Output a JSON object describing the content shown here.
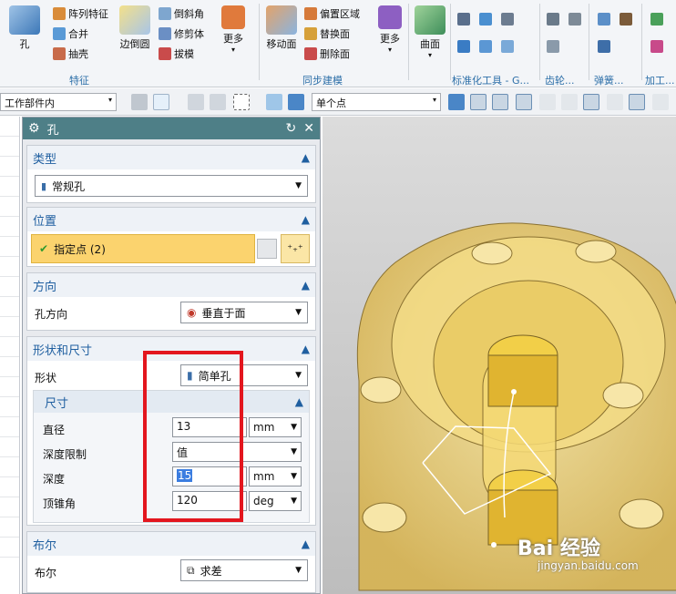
{
  "ribbon": {
    "g1": {
      "hole": "孔",
      "array": "阵列特征",
      "combine": "合并",
      "shell": "抽壳",
      "label": "特征"
    },
    "g2": {
      "edge_blend": "边倒圆",
      "chamfer": "倒斜角",
      "trim": "修剪体",
      "draft": "拔模",
      "more": "更多"
    },
    "g3": {
      "move_face": "移动面",
      "offset_region": "偏置区域",
      "replace_face": "替换面",
      "delete_face": "删除面",
      "more": "更多",
      "label": "同步建模"
    },
    "g4": {
      "surface": "曲面",
      "std_label": "标准化工具 - G...",
      "gear_label": "齿轮...",
      "spring_label": "弹簧...",
      "process_label": "加工..."
    }
  },
  "toolbar": {
    "scope": "工作部件内",
    "point_type": "单个点"
  },
  "dialog": {
    "title": "孔",
    "type": {
      "header": "类型",
      "value": "常规孔"
    },
    "position": {
      "header": "位置",
      "specify_point": "指定点 (2)"
    },
    "direction": {
      "header": "方向",
      "label": "孔方向",
      "value": "垂直于面"
    },
    "shape": {
      "header": "形状和尺寸",
      "shape_label": "形状",
      "shape_value": "简单孔",
      "dims": {
        "header": "尺寸",
        "diameter_label": "直径",
        "diameter": "13",
        "diameter_unit": "mm",
        "depth_limit_label": "深度限制",
        "depth_limit": "值",
        "depth_label": "深度",
        "depth": "15",
        "depth_unit": "mm",
        "tip_angle_label": "顶锥角",
        "tip_angle": "120",
        "tip_angle_unit": "deg"
      }
    },
    "boolean": {
      "header": "布尔",
      "label": "布尔",
      "value": "求差"
    }
  },
  "watermark": {
    "brand": "Bai 经验",
    "url": "jingyan.baidu.com"
  },
  "colors": {
    "accent": "#4e7f87",
    "highlight": "#fbd36e",
    "section_header": "#1f5fa0",
    "annotation": "#e3161e"
  }
}
